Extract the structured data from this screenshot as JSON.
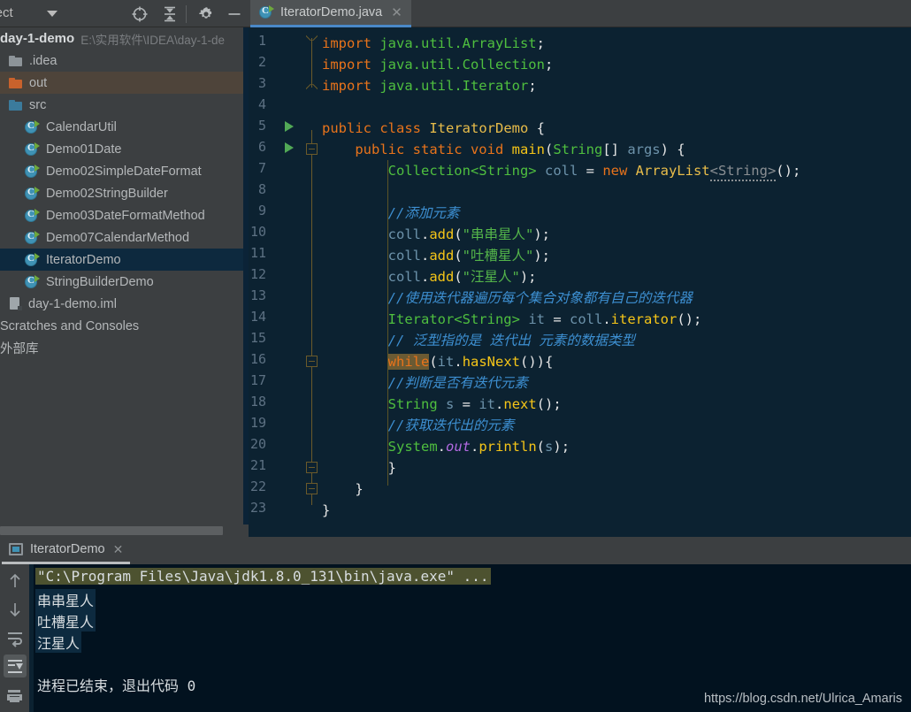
{
  "project_panel": {
    "title": "oject",
    "chevron_icon": "chevron-down-icon",
    "toolbar": [
      {
        "name": "locate-icon",
        "label": "Select Opened File"
      },
      {
        "name": "collapse-all-icon",
        "label": "Collapse All"
      },
      {
        "name": "gear-icon",
        "label": "Settings"
      },
      {
        "name": "hide-icon",
        "label": "Hide"
      }
    ],
    "tree": [
      {
        "label": "day-1-demo",
        "path": "E:\\实用软件\\IDEA\\day-1-de",
        "icon": "",
        "indent": 0,
        "kind": "root",
        "state": "normal"
      },
      {
        "label": ".idea",
        "path": "",
        "icon": "folder-gray-icon",
        "indent": 1,
        "kind": "folder-gray",
        "state": "normal"
      },
      {
        "label": "out",
        "path": "",
        "icon": "folder-orange-icon",
        "indent": 1,
        "kind": "folder-orange",
        "state": "highlight"
      },
      {
        "label": "src",
        "path": "",
        "icon": "folder-blue-icon",
        "indent": 1,
        "kind": "folder-blue",
        "state": "normal"
      },
      {
        "label": "CalendarUtil",
        "path": "",
        "icon": "java-class-icon",
        "indent": 2,
        "kind": "java",
        "state": "normal"
      },
      {
        "label": "Demo01Date",
        "path": "",
        "icon": "java-class-icon",
        "indent": 2,
        "kind": "java",
        "state": "normal"
      },
      {
        "label": "Demo02SimpleDateFormat",
        "path": "",
        "icon": "java-class-icon",
        "indent": 2,
        "kind": "java",
        "state": "normal"
      },
      {
        "label": "Demo02StringBuilder",
        "path": "",
        "icon": "java-class-icon",
        "indent": 2,
        "kind": "java",
        "state": "normal"
      },
      {
        "label": "Demo03DateFormatMethod",
        "path": "",
        "icon": "java-class-icon",
        "indent": 2,
        "kind": "java",
        "state": "normal"
      },
      {
        "label": "Demo07CalendarMethod",
        "path": "",
        "icon": "java-class-icon",
        "indent": 2,
        "kind": "java",
        "state": "normal"
      },
      {
        "label": "IteratorDemo",
        "path": "",
        "icon": "java-class-icon",
        "indent": 2,
        "kind": "java",
        "state": "selected"
      },
      {
        "label": "StringBuilderDemo",
        "path": "",
        "icon": "java-class-icon",
        "indent": 2,
        "kind": "java",
        "state": "normal"
      },
      {
        "label": "day-1-demo.iml",
        "path": "",
        "icon": "iml-file-icon",
        "indent": 1,
        "kind": "iml",
        "state": "normal"
      },
      {
        "label": "Scratches and Consoles",
        "path": "",
        "icon": "",
        "indent": 0,
        "kind": "plain",
        "state": "normal"
      },
      {
        "label": "外部库",
        "path": "",
        "icon": "",
        "indent": 0,
        "kind": "plain",
        "state": "normal"
      }
    ]
  },
  "editor": {
    "tab": {
      "label": "IteratorDemo.java",
      "icon": "java-class-icon",
      "close_icon": "close-icon"
    },
    "line_numbers": [
      "1",
      "2",
      "3",
      "4",
      "5",
      "6",
      "7",
      "8",
      "9",
      "10",
      "11",
      "12",
      "13",
      "14",
      "15",
      "16",
      "17",
      "18",
      "19",
      "20",
      "21",
      "22",
      "23"
    ],
    "code_lines": [
      "import java.util.ArrayList;",
      "import java.util.Collection;",
      "import java.util.Iterator;",
      "",
      "public class IteratorDemo {",
      "    public static void main(String[] args) {",
      "        Collection<String> coll = new ArrayList<String>();",
      "",
      "        //添加元素",
      "        coll.add(\"串串星人\");",
      "        coll.add(\"吐槽星人\");",
      "        coll.add(\"汪星人\");",
      "        //使用迭代器遍历每个集合对象都有自己的迭代器",
      "        Iterator<String> it = coll.iterator();",
      "        // 泛型指的是 迭代出 元素的数据类型",
      "        while(it.hasNext()){",
      "        //判断是否有迭代元素",
      "        String s = it.next();",
      "        //获取迭代出的元素",
      "        System.out.println(s);",
      "        }",
      "    }",
      "}"
    ],
    "run_markers_on_lines": [
      5,
      6
    ]
  },
  "run_panel": {
    "tab": {
      "label": "IteratorDemo",
      "icon": "console-icon",
      "close_icon": "close-icon"
    },
    "sidebar_buttons": [
      {
        "name": "up-arrow-icon",
        "label": "Up the stack trace",
        "active": false
      },
      {
        "name": "down-arrow-icon",
        "label": "Down the stack trace",
        "active": false
      },
      {
        "name": "soft-wrap-icon",
        "label": "Soft-Wrap",
        "active": false
      },
      {
        "name": "scroll-to-end-icon",
        "label": "Scroll to the end",
        "active": true
      },
      {
        "name": "print-icon",
        "label": "Print",
        "active": false
      }
    ],
    "console_lines": [
      {
        "text": "\"C:\\Program Files\\Java\\jdk1.8.0_131\\bin\\java.exe\" ...",
        "style": "command"
      },
      {
        "text": "串串星人",
        "style": "selected"
      },
      {
        "text": "吐槽星人",
        "style": "selected"
      },
      {
        "text": "汪星人",
        "style": "selected"
      },
      {
        "text": "",
        "style": "plain"
      },
      {
        "text": "进程已结束，退出代码 0",
        "style": "plain"
      }
    ]
  },
  "watermark": {
    "text": "https://blog.csdn.net/Ulrica_Amaris"
  },
  "colors": {
    "panel_bg": "#3c3f41",
    "editor_bg": "#0c2231",
    "console_bg": "#02121f",
    "selection": "#0d293e",
    "tab_underline": "#4a88c7",
    "keyword": "#e8731b",
    "type": "#4fbf3f",
    "string": "#54b54a",
    "method": "#f5c518",
    "comment": "#3d8fd1",
    "variable": "#6d93ab"
  }
}
